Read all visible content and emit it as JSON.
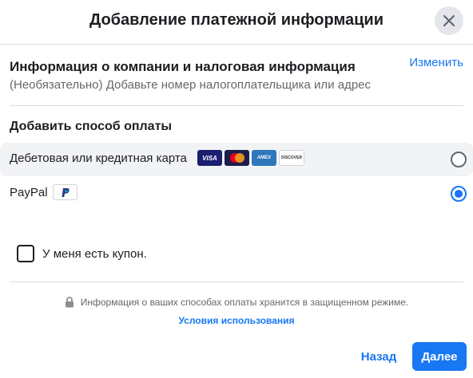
{
  "dialog": {
    "title": "Добавление платежной информации"
  },
  "company": {
    "title": "Информация о компании и налоговая информация",
    "subtitle": "(Необязательно) Добавьте номер налогоплательщика или адрес",
    "edit_label": "Изменить"
  },
  "payment": {
    "section_title": "Добавить способ оплаты",
    "options": [
      {
        "label": "Дебетовая или кредитная карта",
        "selected": false,
        "logos": [
          "VISA",
          "mastercard",
          "AMEX",
          "DISCOVER"
        ]
      },
      {
        "label": "PayPal",
        "selected": true,
        "logos": [
          "paypal"
        ]
      }
    ]
  },
  "coupon": {
    "label": "У меня есть купон.",
    "checked": false
  },
  "footer": {
    "secure_text": "Информация о ваших способах оплаты хранится в защищенном режиме.",
    "terms_label": "Условия использования",
    "back_label": "Назад",
    "next_label": "Далее"
  },
  "colors": {
    "accent": "#1877f2",
    "selected_row_bg": "#f2f3f5",
    "muted_text": "#65676b"
  }
}
